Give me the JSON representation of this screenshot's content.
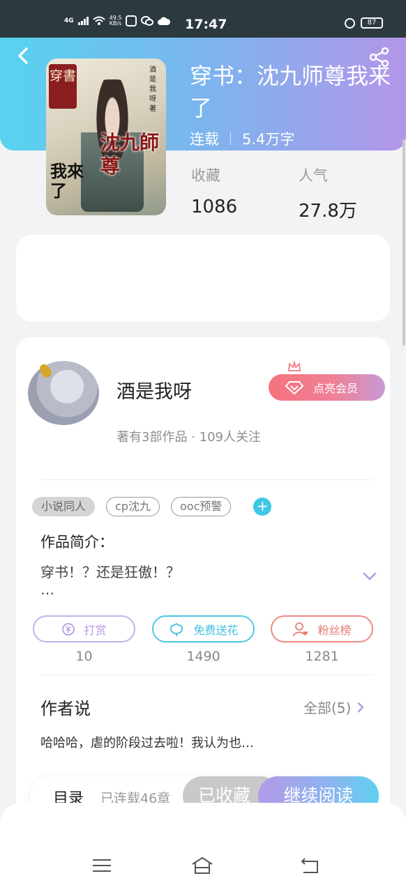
{
  "status_bar": {
    "network": "4G",
    "speed_value": "49.5",
    "speed_unit": "KB/s",
    "time": "17:47",
    "battery": "87"
  },
  "book": {
    "title": "穿书：沈九师尊我来了",
    "status": "连载",
    "word_count": "5.4万字",
    "stats": [
      {
        "label": "收藏",
        "value": "1086"
      },
      {
        "label": "人气",
        "value": "27.8万"
      }
    ],
    "cover": {
      "tag": "穿書",
      "author_vertical": "酒是我呀 著",
      "title_art": "沈九師尊",
      "subtitle_art": "我來了"
    }
  },
  "author": {
    "name": "酒是我呀",
    "meta": "著有3部作品 · 109人关注",
    "vip_label": "点亮会员"
  },
  "tags": [
    "小说同人",
    "cp沈九",
    "ooc预警"
  ],
  "intro": {
    "label": "作品简介：",
    "text": "穿书！？还是狂傲！？",
    "ellipsis": "…"
  },
  "actions": [
    {
      "label": "打赏",
      "count": "10",
      "color": "#b79ae8",
      "icon": "coin-icon"
    },
    {
      "label": "免费送花",
      "count": "1490",
      "color": "#4cc8e6",
      "icon": "flower-icon"
    },
    {
      "label": "粉丝榜",
      "count": "1281",
      "color": "#ee8078",
      "icon": "fans-icon"
    }
  ],
  "author_says": {
    "title": "作者说",
    "all_label": "全部(5)",
    "text": "哈哈哈，虐的阶段过去啦！我认为也…"
  },
  "bottom_bar": {
    "toc_label": "目录",
    "toc_meta": "已连载46章",
    "favorite_label": "已收藏",
    "read_label": "继续阅读"
  }
}
